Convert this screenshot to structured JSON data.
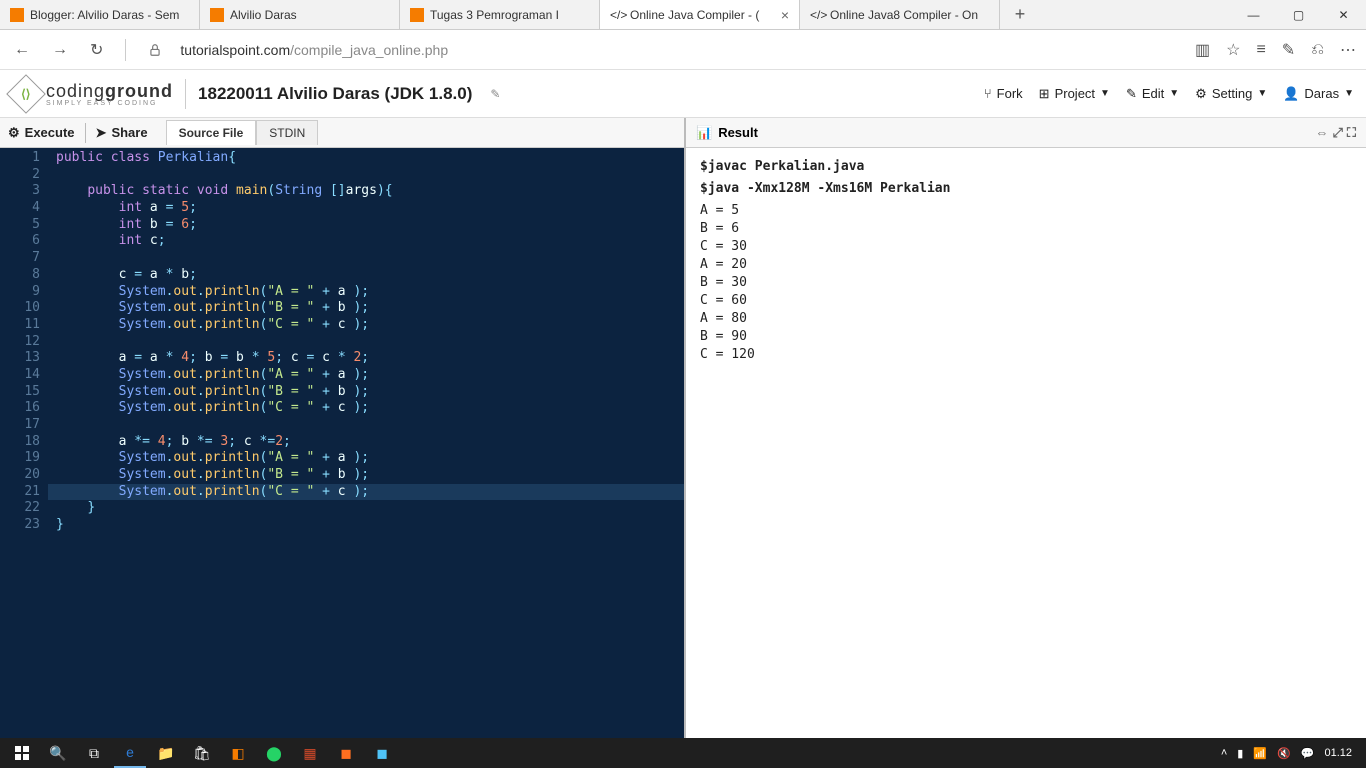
{
  "browser": {
    "tabs": [
      {
        "title": "Blogger: Alvilio Daras - Sem",
        "favicon": "orange"
      },
      {
        "title": "Alvilio Daras",
        "favicon": "orange"
      },
      {
        "title": "Tugas 3 Pemrograman I",
        "favicon": "orange"
      },
      {
        "title": "Online Java Compiler - (",
        "favicon": "tp",
        "active": true
      },
      {
        "title": "Online Java8 Compiler - On",
        "favicon": "tp"
      }
    ],
    "url_prefix": "tutorialspoint.com",
    "url_suffix": "/compile_java_online.php"
  },
  "app": {
    "logo_main": "coding",
    "logo_bold": "ground",
    "logo_sub": "SIMPLY EASY CODING",
    "project_title": "18220011 Alvilio Daras (JDK 1.8.0)",
    "actions": {
      "fork": "Fork",
      "project": "Project",
      "edit": "Edit",
      "setting": "Setting",
      "user": "Daras"
    }
  },
  "toolbar": {
    "execute": "Execute",
    "share": "Share",
    "tabs": [
      "Source File",
      "STDIN"
    ],
    "active_tab": 0
  },
  "result": {
    "label": "Result",
    "cmd1": "$javac Perkalian.java",
    "cmd2": "$java -Xmx128M -Xms16M Perkalian",
    "output": [
      "A = 5",
      "B = 6",
      "C = 30",
      "A = 20",
      "B = 30",
      "C = 60",
      "A = 80",
      "B = 90",
      "C = 120"
    ]
  },
  "code": {
    "lines": 23,
    "highlight_line": 21,
    "tokens": [
      [
        [
          "kw",
          "public"
        ],
        [
          "wh",
          " "
        ],
        [
          "kw",
          "class"
        ],
        [
          "wh",
          " "
        ],
        [
          "cls",
          "Perkalian"
        ],
        [
          "pn",
          "{"
        ]
      ],
      [],
      [
        [
          "wh",
          "    "
        ],
        [
          "kw",
          "public"
        ],
        [
          "wh",
          " "
        ],
        [
          "kw",
          "static"
        ],
        [
          "wh",
          " "
        ],
        [
          "kw",
          "void"
        ],
        [
          "wh",
          " "
        ],
        [
          "id",
          "main"
        ],
        [
          "pn",
          "("
        ],
        [
          "type",
          "String"
        ],
        [
          "wh",
          " "
        ],
        [
          "pn",
          "[]"
        ],
        [
          "wh",
          "args"
        ],
        [
          "pn",
          ")"
        ],
        [
          "pn",
          "{"
        ]
      ],
      [
        [
          "wh",
          "        "
        ],
        [
          "kw",
          "int"
        ],
        [
          "wh",
          " a "
        ],
        [
          "pn",
          "="
        ],
        [
          "wh",
          " "
        ],
        [
          "num",
          "5"
        ],
        [
          "pn",
          ";"
        ]
      ],
      [
        [
          "wh",
          "        "
        ],
        [
          "kw",
          "int"
        ],
        [
          "wh",
          " b "
        ],
        [
          "pn",
          "="
        ],
        [
          "wh",
          " "
        ],
        [
          "num",
          "6"
        ],
        [
          "pn",
          ";"
        ]
      ],
      [
        [
          "wh",
          "        "
        ],
        [
          "kw",
          "int"
        ],
        [
          "wh",
          " c"
        ],
        [
          "pn",
          ";"
        ]
      ],
      [],
      [
        [
          "wh",
          "        c "
        ],
        [
          "pn",
          "="
        ],
        [
          "wh",
          " a "
        ],
        [
          "pn",
          "*"
        ],
        [
          "wh",
          " b"
        ],
        [
          "pn",
          ";"
        ]
      ],
      [
        [
          "wh",
          "        "
        ],
        [
          "type",
          "System"
        ],
        [
          "pn",
          "."
        ],
        [
          "id",
          "out"
        ],
        [
          "pn",
          "."
        ],
        [
          "id",
          "println"
        ],
        [
          "pn",
          "("
        ],
        [
          "str",
          "\"A = \""
        ],
        [
          "wh",
          " "
        ],
        [
          "pn",
          "+"
        ],
        [
          "wh",
          " a "
        ],
        [
          "pn",
          ")"
        ],
        [
          "pn",
          ";"
        ]
      ],
      [
        [
          "wh",
          "        "
        ],
        [
          "type",
          "System"
        ],
        [
          "pn",
          "."
        ],
        [
          "id",
          "out"
        ],
        [
          "pn",
          "."
        ],
        [
          "id",
          "println"
        ],
        [
          "pn",
          "("
        ],
        [
          "str",
          "\"B = \""
        ],
        [
          "wh",
          " "
        ],
        [
          "pn",
          "+"
        ],
        [
          "wh",
          " b "
        ],
        [
          "pn",
          ")"
        ],
        [
          "pn",
          ";"
        ]
      ],
      [
        [
          "wh",
          "        "
        ],
        [
          "type",
          "System"
        ],
        [
          "pn",
          "."
        ],
        [
          "id",
          "out"
        ],
        [
          "pn",
          "."
        ],
        [
          "id",
          "println"
        ],
        [
          "pn",
          "("
        ],
        [
          "str",
          "\"C = \""
        ],
        [
          "wh",
          " "
        ],
        [
          "pn",
          "+"
        ],
        [
          "wh",
          " c "
        ],
        [
          "pn",
          ")"
        ],
        [
          "pn",
          ";"
        ]
      ],
      [],
      [
        [
          "wh",
          "        a "
        ],
        [
          "pn",
          "="
        ],
        [
          "wh",
          " a "
        ],
        [
          "pn",
          "*"
        ],
        [
          "wh",
          " "
        ],
        [
          "num",
          "4"
        ],
        [
          "pn",
          ";"
        ],
        [
          "wh",
          " b "
        ],
        [
          "pn",
          "="
        ],
        [
          "wh",
          " b "
        ],
        [
          "pn",
          "*"
        ],
        [
          "wh",
          " "
        ],
        [
          "num",
          "5"
        ],
        [
          "pn",
          ";"
        ],
        [
          "wh",
          " c "
        ],
        [
          "pn",
          "="
        ],
        [
          "wh",
          " c "
        ],
        [
          "pn",
          "*"
        ],
        [
          "wh",
          " "
        ],
        [
          "num",
          "2"
        ],
        [
          "pn",
          ";"
        ]
      ],
      [
        [
          "wh",
          "        "
        ],
        [
          "type",
          "System"
        ],
        [
          "pn",
          "."
        ],
        [
          "id",
          "out"
        ],
        [
          "pn",
          "."
        ],
        [
          "id",
          "println"
        ],
        [
          "pn",
          "("
        ],
        [
          "str",
          "\"A = \""
        ],
        [
          "wh",
          " "
        ],
        [
          "pn",
          "+"
        ],
        [
          "wh",
          " a "
        ],
        [
          "pn",
          ")"
        ],
        [
          "pn",
          ";"
        ]
      ],
      [
        [
          "wh",
          "        "
        ],
        [
          "type",
          "System"
        ],
        [
          "pn",
          "."
        ],
        [
          "id",
          "out"
        ],
        [
          "pn",
          "."
        ],
        [
          "id",
          "println"
        ],
        [
          "pn",
          "("
        ],
        [
          "str",
          "\"B = \""
        ],
        [
          "wh",
          " "
        ],
        [
          "pn",
          "+"
        ],
        [
          "wh",
          " b "
        ],
        [
          "pn",
          ")"
        ],
        [
          "pn",
          ";"
        ]
      ],
      [
        [
          "wh",
          "        "
        ],
        [
          "type",
          "System"
        ],
        [
          "pn",
          "."
        ],
        [
          "id",
          "out"
        ],
        [
          "pn",
          "."
        ],
        [
          "id",
          "println"
        ],
        [
          "pn",
          "("
        ],
        [
          "str",
          "\"C = \""
        ],
        [
          "wh",
          " "
        ],
        [
          "pn",
          "+"
        ],
        [
          "wh",
          " c "
        ],
        [
          "pn",
          ")"
        ],
        [
          "pn",
          ";"
        ]
      ],
      [],
      [
        [
          "wh",
          "        a "
        ],
        [
          "pn",
          "*="
        ],
        [
          "wh",
          " "
        ],
        [
          "num",
          "4"
        ],
        [
          "pn",
          ";"
        ],
        [
          "wh",
          " b "
        ],
        [
          "pn",
          "*="
        ],
        [
          "wh",
          " "
        ],
        [
          "num",
          "3"
        ],
        [
          "pn",
          ";"
        ],
        [
          "wh",
          " c "
        ],
        [
          "pn",
          "*="
        ],
        [
          "num",
          "2"
        ],
        [
          "pn",
          ";"
        ]
      ],
      [
        [
          "wh",
          "        "
        ],
        [
          "type",
          "System"
        ],
        [
          "pn",
          "."
        ],
        [
          "id",
          "out"
        ],
        [
          "pn",
          "."
        ],
        [
          "id",
          "println"
        ],
        [
          "pn",
          "("
        ],
        [
          "str",
          "\"A = \""
        ],
        [
          "wh",
          " "
        ],
        [
          "pn",
          "+"
        ],
        [
          "wh",
          " a "
        ],
        [
          "pn",
          ")"
        ],
        [
          "pn",
          ";"
        ]
      ],
      [
        [
          "wh",
          "        "
        ],
        [
          "type",
          "System"
        ],
        [
          "pn",
          "."
        ],
        [
          "id",
          "out"
        ],
        [
          "pn",
          "."
        ],
        [
          "id",
          "println"
        ],
        [
          "pn",
          "("
        ],
        [
          "str",
          "\"B = \""
        ],
        [
          "wh",
          " "
        ],
        [
          "pn",
          "+"
        ],
        [
          "wh",
          " b "
        ],
        [
          "pn",
          ")"
        ],
        [
          "pn",
          ";"
        ]
      ],
      [
        [
          "wh",
          "        "
        ],
        [
          "type",
          "System"
        ],
        [
          "pn",
          "."
        ],
        [
          "id",
          "out"
        ],
        [
          "pn",
          "."
        ],
        [
          "id",
          "println"
        ],
        [
          "pn",
          "("
        ],
        [
          "str",
          "\"C = \""
        ],
        [
          "wh",
          " "
        ],
        [
          "pn",
          "+"
        ],
        [
          "wh",
          " c "
        ],
        [
          "pn",
          ")"
        ],
        [
          "pn",
          ";"
        ]
      ],
      [
        [
          "wh",
          "    "
        ],
        [
          "pn",
          "}"
        ]
      ],
      [
        [
          "pn",
          "}"
        ]
      ]
    ]
  },
  "taskbar": {
    "time": "01.12"
  }
}
